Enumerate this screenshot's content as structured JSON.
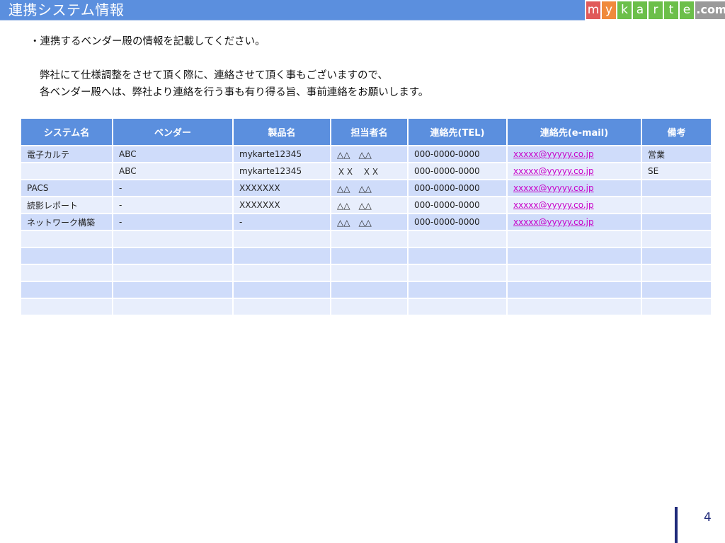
{
  "header": {
    "title": "連携システム情報"
  },
  "logo": {
    "letters": [
      {
        "char": "m",
        "color": "#e05a5a"
      },
      {
        "char": "y",
        "color": "#f08a3c"
      },
      {
        "char": "k",
        "color": "#6cbf4a"
      },
      {
        "char": "a",
        "color": "#6cbf4a"
      },
      {
        "char": "r",
        "color": "#6cbf4a"
      },
      {
        "char": "t",
        "color": "#6cbf4a"
      },
      {
        "char": "e",
        "color": "#6cbf4a"
      }
    ],
    "suffix": ".com",
    "suffix_color": "#9a9a9a"
  },
  "intro": {
    "line1": "・連携するベンダー殿の情報を記載してください。",
    "line2": "弊社にて仕様調整をさせて頂く際に、連絡させて頂く事もございますので、",
    "line3": "各ベンダー殿へは、弊社より連絡を行う事も有り得る旨、事前連絡をお願いします。"
  },
  "table": {
    "headers": [
      "システム名",
      "ベンダー",
      "製品名",
      "担当者名",
      "連絡先(TEL)",
      "連絡先(e-mail)",
      "備考"
    ],
    "rows": [
      [
        "電子カルテ",
        "ABC",
        "mykarte12345",
        "△△　△△",
        "000-0000-0000",
        "xxxxx@yyyyy.co.jp",
        "営業"
      ],
      [
        "",
        "ABC",
        "mykarte12345",
        "ＸＸ　ＸＸ",
        "000-0000-0000",
        "xxxxx@yyyyy.co.jp",
        "SE"
      ],
      [
        "PACS",
        "-",
        "XXXXXXX",
        "△△　△△",
        "000-0000-0000",
        "xxxxx@yyyyy.co.jp",
        ""
      ],
      [
        "読影レポート",
        "-",
        "XXXXXXX",
        "△△　△△",
        "000-0000-0000",
        "xxxxx@yyyyy.co.jp",
        ""
      ],
      [
        "ネットワーク構築",
        "-",
        "-",
        "△△　△△",
        "000-0000-0000",
        "xxxxx@yyyyy.co.jp",
        ""
      ],
      [
        "",
        "",
        "",
        "",
        "",
        "",
        ""
      ],
      [
        "",
        "",
        "",
        "",
        "",
        "",
        ""
      ],
      [
        "",
        "",
        "",
        "",
        "",
        "",
        ""
      ],
      [
        "",
        "",
        "",
        "",
        "",
        "",
        ""
      ],
      [
        "",
        "",
        "",
        "",
        "",
        "",
        ""
      ]
    ]
  },
  "footer": {
    "page_number": "4"
  },
  "colors": {
    "title_bar": "#5b8fde",
    "header_bg": "#5b8fde",
    "row_odd": "#cfdcfa",
    "row_even": "#e8eefc",
    "link": "#c800c8",
    "page_accent": "#1f2a7a"
  }
}
